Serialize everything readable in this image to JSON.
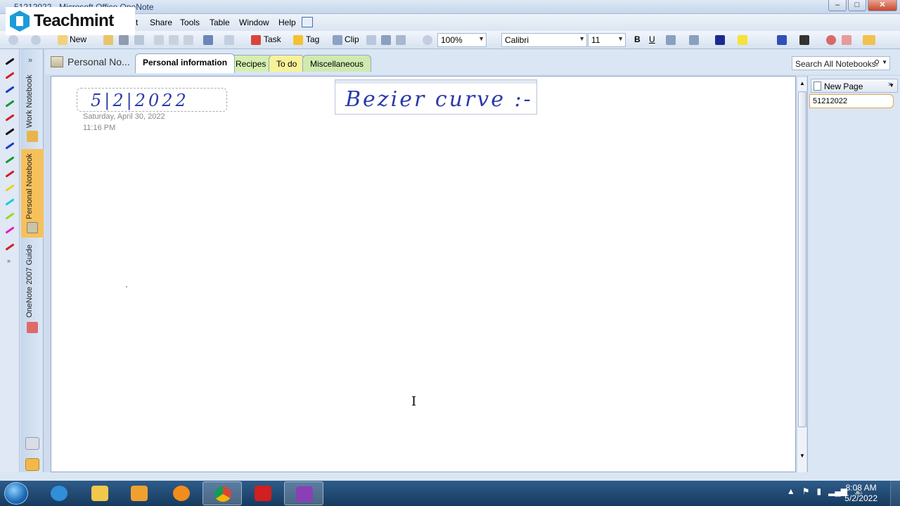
{
  "window": {
    "title": "51212022 - Microsoft Office OneNote",
    "buttons": {
      "minimize": "–",
      "maximize": "□",
      "close": "✕"
    }
  },
  "logo": {
    "text": "Teachmint"
  },
  "menu": {
    "partial_item": "t",
    "items": [
      "Share",
      "Tools",
      "Table",
      "Window",
      "Help"
    ]
  },
  "toolbar": {
    "new_label": "New",
    "task_label": "Task",
    "tag_label": "Tag",
    "clip_label": "Clip",
    "zoom": "100%",
    "font": "Calibri",
    "font_size": "11",
    "bold": "B",
    "underline": "U"
  },
  "notebooks": [
    {
      "label": "Work Notebook",
      "color": "#e8b54a"
    },
    {
      "label": "Personal Notebook",
      "color": "#c9c3a8",
      "active": true
    },
    {
      "label": "OneNote 2007 Guide",
      "color": "#e06a6a"
    }
  ],
  "notebook_title": "Personal No...",
  "sections": [
    {
      "label": "Personal information",
      "color": "#ffffff",
      "active": true
    },
    {
      "label": "Recipes",
      "color": "#d6efb0"
    },
    {
      "label": "To do",
      "color": "#f7f29a"
    },
    {
      "label": "Miscellaneous",
      "color": "#cfeab0"
    }
  ],
  "search": {
    "placeholder": "Search All Notebooks"
  },
  "page": {
    "handwritten_date": "5|2|2022",
    "date": "Saturday, April 30, 2022",
    "time": "11:16 PM",
    "handwritten_note": "Bezier curve :-"
  },
  "page_pane": {
    "new_page_label": "New Page",
    "pages": [
      "51212022"
    ]
  },
  "taskbar": {
    "apps": [
      {
        "name": "internet-explorer",
        "color": "#2f8fd8"
      },
      {
        "name": "file-explorer",
        "color": "#f1c84b"
      },
      {
        "name": "media-player",
        "color": "#f0a030"
      },
      {
        "name": "avast",
        "color": "#f28c1c"
      },
      {
        "name": "chrome",
        "color": "#db4437",
        "active": true
      },
      {
        "name": "acrobat",
        "color": "#d21f1f"
      },
      {
        "name": "onenote",
        "color": "#8b3fb5",
        "active": true
      }
    ],
    "clock": {
      "time": "8:08 AM",
      "date": "5/2/2022"
    }
  },
  "colors": {
    "ink": "#2b3aa8",
    "active_section_border": "#e3a650",
    "active_notebook": "#f6c15b"
  }
}
